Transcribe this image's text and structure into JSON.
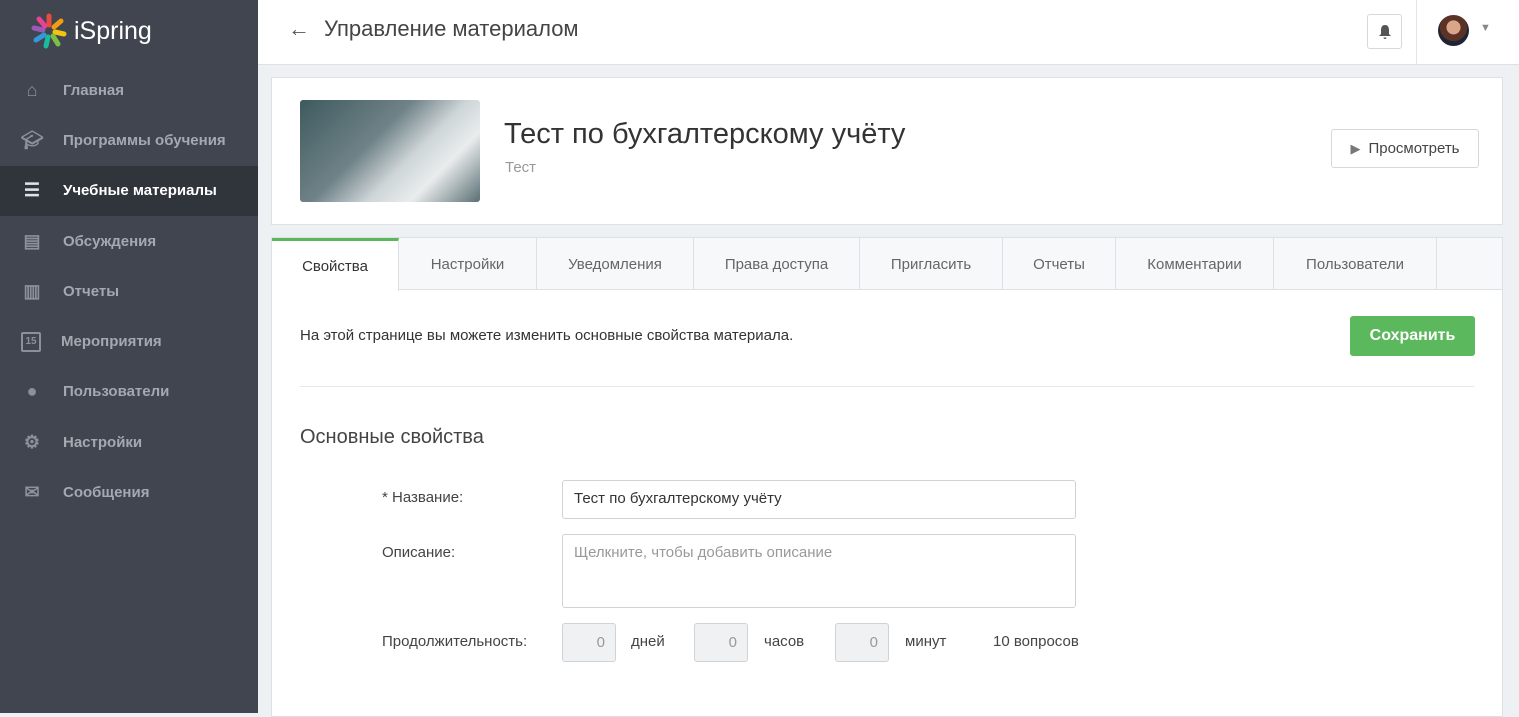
{
  "app": {
    "logo_text": "iSpring"
  },
  "sidebar": {
    "items": [
      {
        "label": "Главная",
        "icon": "home-icon"
      },
      {
        "label": "Программы обучения",
        "icon": "graduation-cap-icon"
      },
      {
        "label": "Учебные материалы",
        "icon": "notepad-icon",
        "active": true
      },
      {
        "label": "Обсуждения",
        "icon": "chat-icon"
      },
      {
        "label": "Отчеты",
        "icon": "bar-chart-icon"
      },
      {
        "label": "Мероприятия",
        "icon": "calendar-icon",
        "badge": "15"
      },
      {
        "label": "Пользователи",
        "icon": "user-icon"
      },
      {
        "label": "Настройки",
        "icon": "gear-icon"
      },
      {
        "label": "Сообщения",
        "icon": "envelope-icon"
      }
    ]
  },
  "header": {
    "title": "Управление материалом",
    "back": "←"
  },
  "material": {
    "title": "Тест по бухгалтерскому учёту",
    "type": "Тест",
    "preview_label": "Просмотреть"
  },
  "tabs": [
    "Свойства",
    "Настройки",
    "Уведомления",
    "Права доступа",
    "Пригласить",
    "Отчеты",
    "Комментарии",
    "Пользователи"
  ],
  "properties": {
    "intro": "На этой странице вы можете изменить основные свойства материала.",
    "save_label": "Сохранить",
    "section_title": "Основные свойства",
    "name_label": "* Название:",
    "name_value": "Тест по бухгалтерскому учёту",
    "description_label": "Описание:",
    "description_placeholder": "Щелкните, чтобы добавить описание",
    "duration_label": "Продолжительность:",
    "days": "0",
    "days_label": "дней",
    "hours": "0",
    "hours_label": "часов",
    "minutes": "0",
    "minutes_label": "минут",
    "questions": "10 вопросов"
  },
  "colors": {
    "sidebar": "#40454f",
    "accent": "#5cb85c"
  }
}
